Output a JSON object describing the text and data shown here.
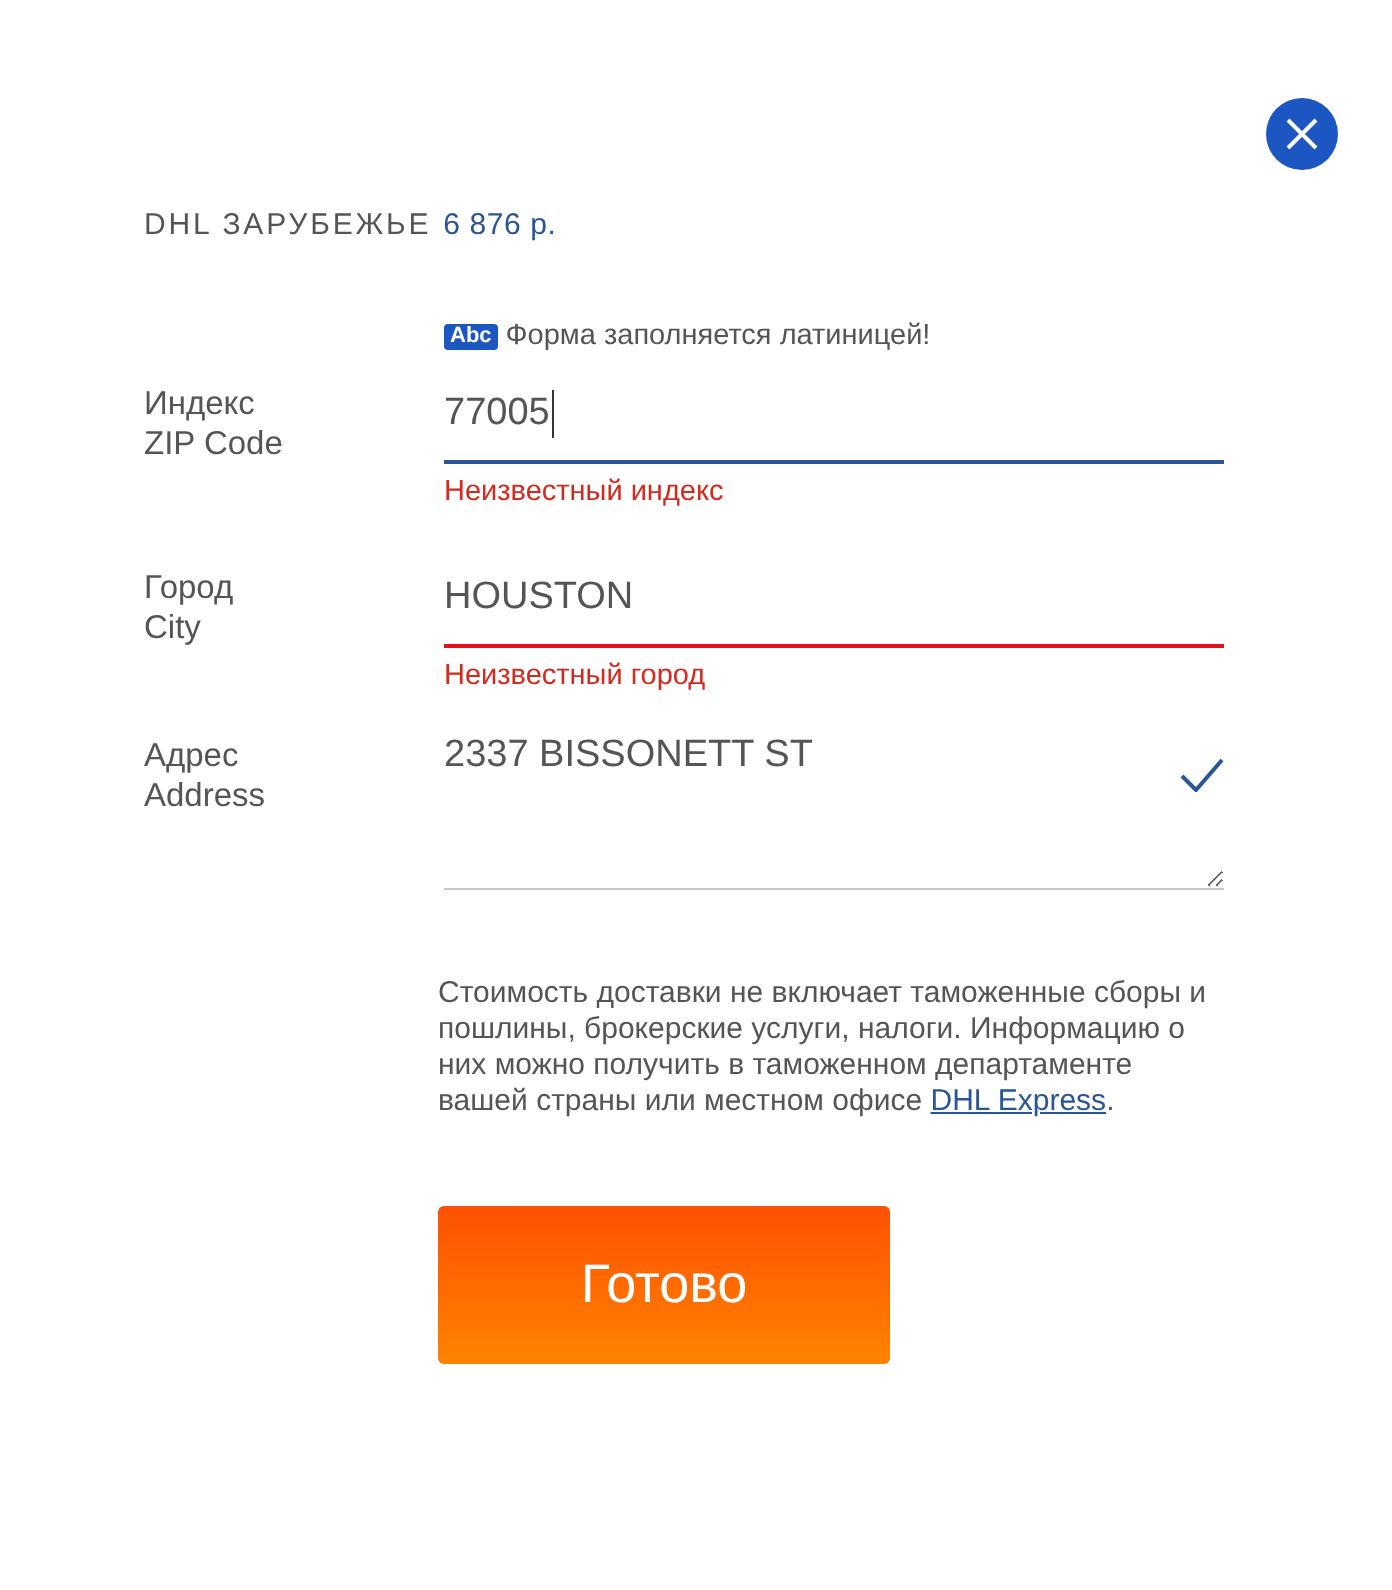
{
  "header": {
    "title": "DHL ЗАРУБЕЖЬЕ",
    "price": "6 876 р."
  },
  "notice": {
    "badge": "Abc",
    "text": "Форма заполняется латиницей!"
  },
  "fields": [
    {
      "kind": "input",
      "label": "Индекс",
      "label_en": "ZIP Code",
      "value": "77005",
      "focused": true,
      "valid": false,
      "error": "Неизвестный индекс"
    },
    {
      "kind": "input",
      "label": "Город",
      "label_en": "City",
      "value": "HOUSTON",
      "focused": false,
      "valid": false,
      "error": "Неизвестный город"
    },
    {
      "kind": "textarea",
      "label": "Адрес",
      "label_en": "Address",
      "value": "2337 BISSONETT ST",
      "focused": false,
      "valid": true
    }
  ],
  "disclaimer": {
    "text": "Стоимость доставки не включает таможенные сборы и пошлины, брокерские услуги, налоги. Информацию о них можно получить в таможенном департаменте вашей страны или местном офисе",
    "link": "DHL Express",
    "end": "."
  },
  "submit_button": {
    "label": "Готово"
  }
}
